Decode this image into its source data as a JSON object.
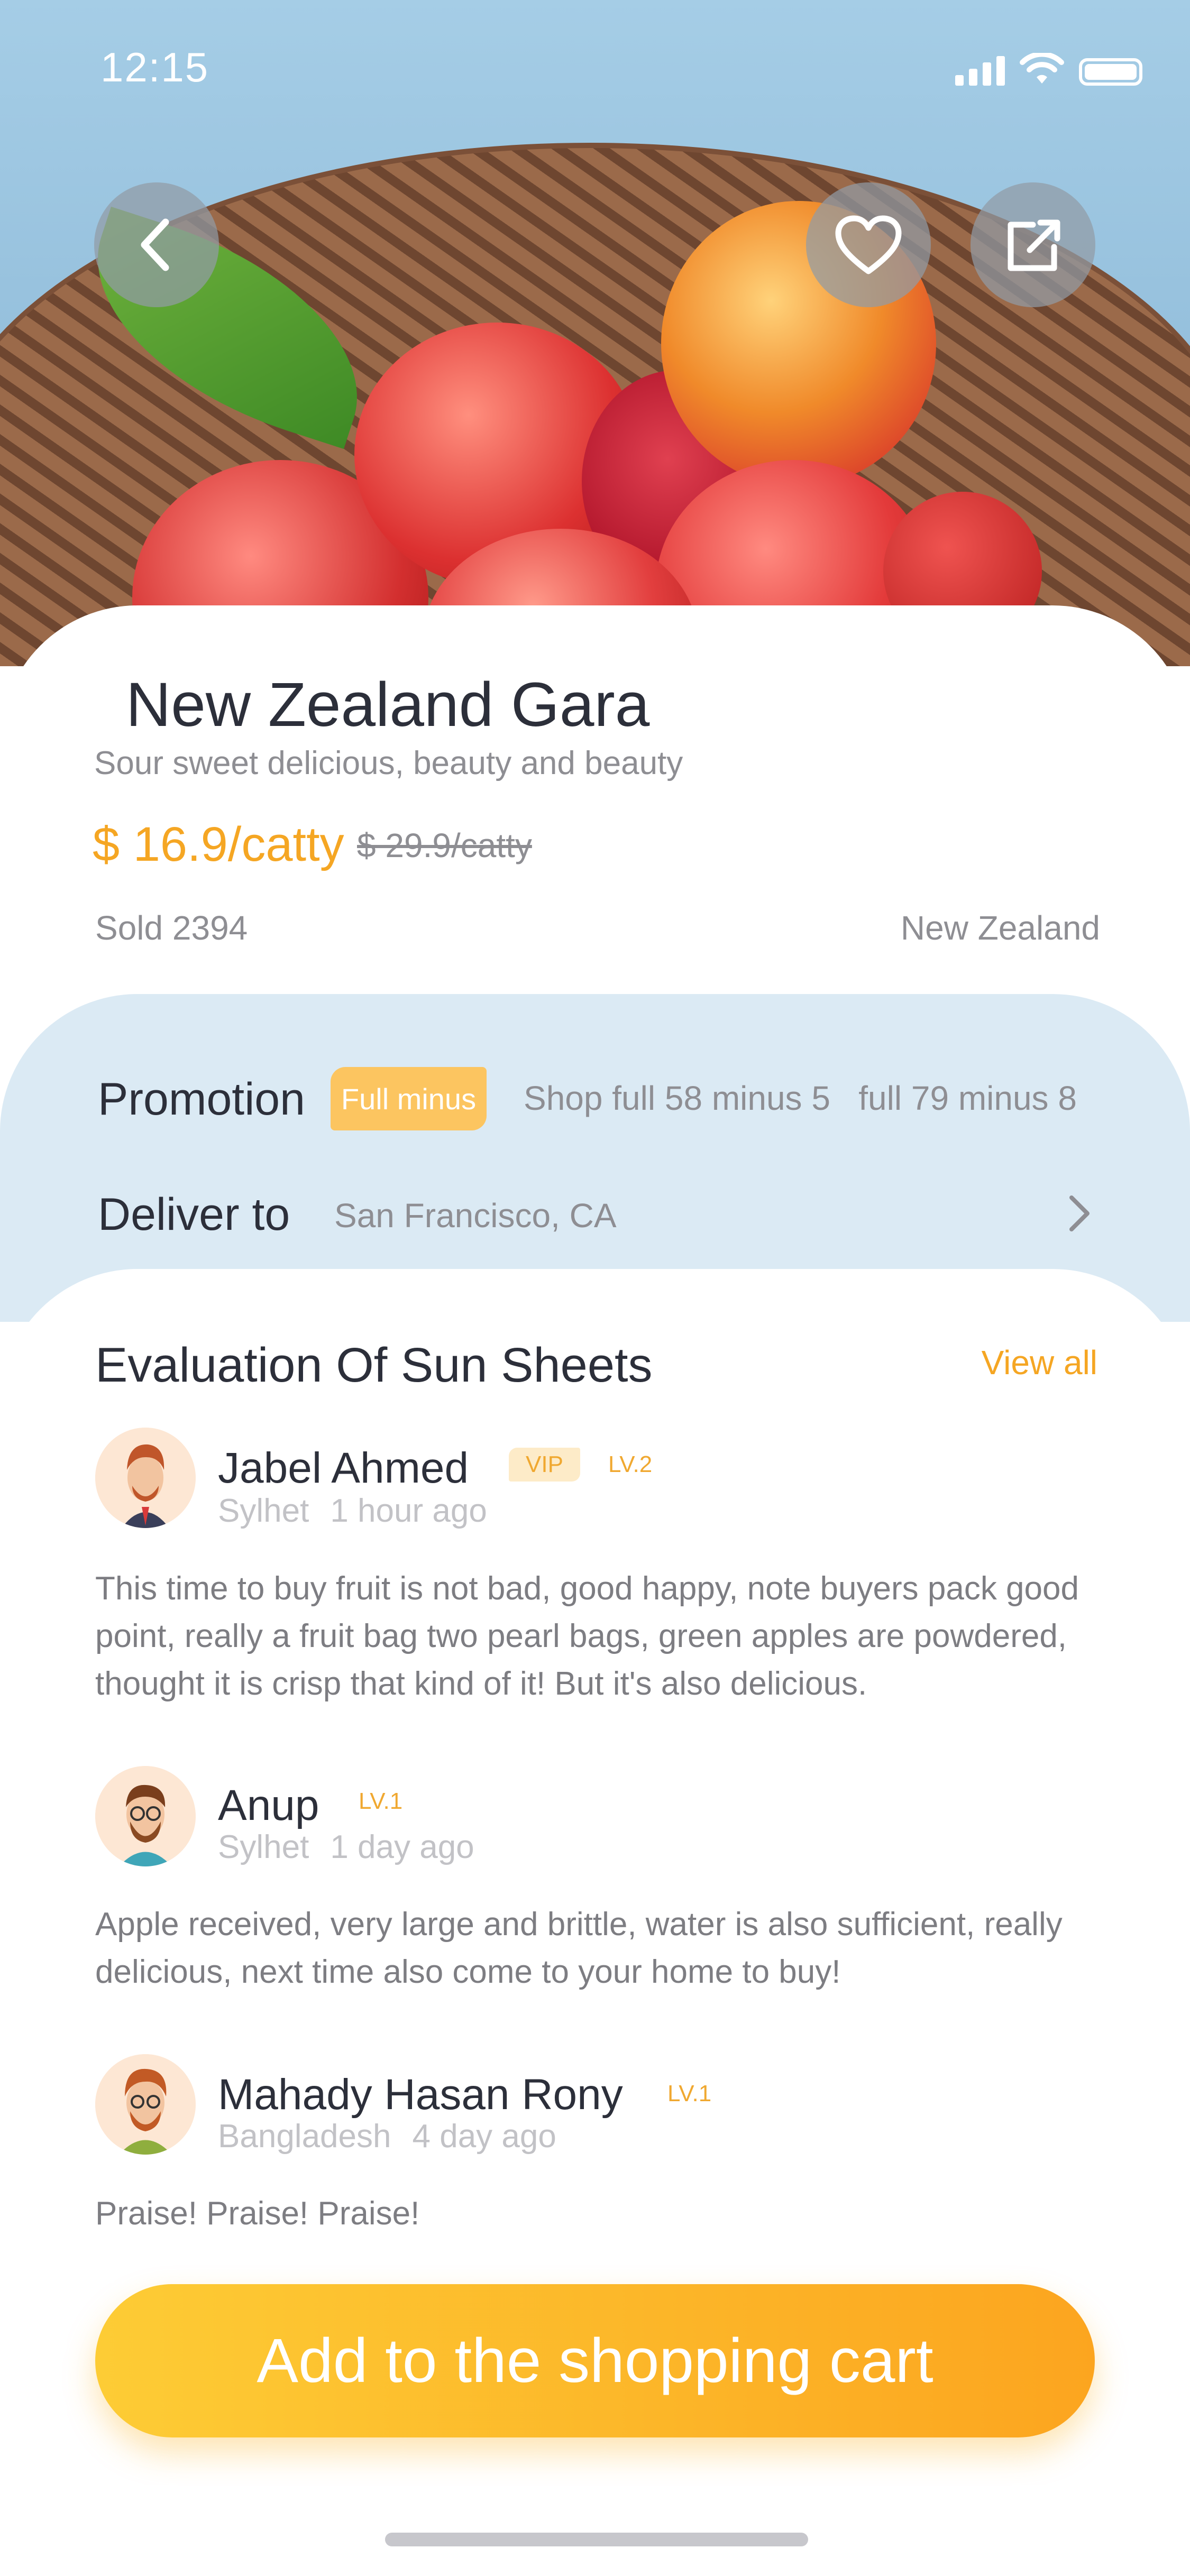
{
  "status_bar": {
    "time": "12:15"
  },
  "product": {
    "title": "New Zealand Gara",
    "subtitle": "Sour sweet delicious, beauty and beauty",
    "price": "$ 16.9/catty",
    "old_price": "$ 29.9/catty",
    "sold": "Sold 2394",
    "origin": "New Zealand"
  },
  "promotion": {
    "label": "Promotion",
    "tag": "Full minus",
    "text": "Shop full 58 minus 5   full 79 minus 8"
  },
  "delivery": {
    "label": "Deliver to",
    "value": "San Francisco, CA"
  },
  "evaluation": {
    "title": "Evaluation Of Sun Sheets",
    "view_all": "View all",
    "reviews": [
      {
        "name": "Jabel Ahmed",
        "vip": "VIP",
        "level": "LV.2",
        "location": "Sylhet",
        "time": "1 hour ago",
        "text": "This time to buy fruit is not bad, good happy, note buyers pack good point, really a fruit bag two pearl bags, green apples are powdered, thought it is crisp that kind of it! But it's also delicious."
      },
      {
        "name": "Anup",
        "level": "LV.1",
        "location": "Sylhet",
        "time": "1 day ago",
        "text": "Apple received, very large and brittle, water is also sufficient, really delicious, next time also come to your home to buy!"
      },
      {
        "name": "Mahady Hasan Rony",
        "level": "LV.1",
        "location": "Bangladesh",
        "time": "4 day ago",
        "text": "Praise! Praise! Praise!"
      }
    ]
  },
  "cart_button": "Add to the shopping cart",
  "colors": {
    "accent": "#f5a623",
    "promo_bg": "#dbeaf4",
    "button_start": "#fdcc35",
    "button_end": "#fca51f"
  },
  "icons": [
    "back-arrow-icon",
    "heart-icon",
    "share-icon",
    "chevron-right-icon",
    "cellular-signal-icon",
    "wifi-icon",
    "battery-icon"
  ]
}
